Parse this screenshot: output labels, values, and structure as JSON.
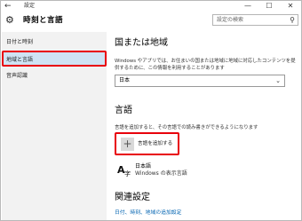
{
  "window": {
    "title": "設定",
    "back_icon": "←",
    "minimize": "—",
    "maximize": "☐",
    "close": "✕"
  },
  "header": {
    "icon": "gear-icon",
    "title": "時刻と言語",
    "search_placeholder": "設定の検索"
  },
  "sidebar": {
    "items": [
      {
        "label": "日付と時刻",
        "selected": false
      },
      {
        "label": "地域と言語",
        "selected": true
      },
      {
        "label": "音声認識",
        "selected": false
      }
    ]
  },
  "region": {
    "heading": "国または地域",
    "description_line1": "Windows やアプリでは、お住まいの国または地域に地域に対応したコンテンツを提",
    "description_line2": "供するために、この情報を利用することがあります",
    "selected_country": "日本"
  },
  "language": {
    "heading": "言語",
    "description": "言語を追加すると、その言語での読み書きができるようになります",
    "add_label": "言語を追加する",
    "items": [
      {
        "name": "日本語",
        "subtitle": "Windows の表示言語"
      }
    ]
  },
  "related": {
    "heading": "関連設定",
    "link": "日付、時刻、地域の追加設定"
  },
  "colors": {
    "accent_link": "#0063b1",
    "highlight_red": "#e8000b",
    "selected_nav": "#cfe3f4"
  }
}
